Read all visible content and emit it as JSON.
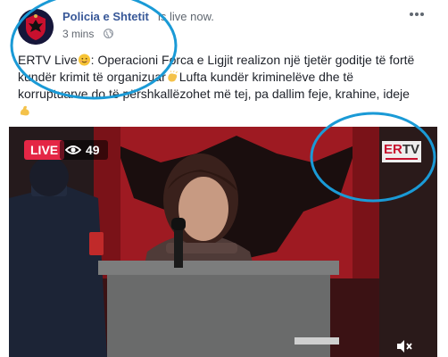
{
  "post": {
    "page_name": "Policia e Shtetit",
    "status_text": "is live now.",
    "timestamp": "3 mins",
    "privacy_icon": "globe-icon",
    "more_icon": "more-options-icon",
    "text_line1_a": "ERTV Live",
    "text_line1_b": ": Operacioni Forca e Ligjit realizon një tjetër goditje të fortë",
    "text_line2_a": "kundër krimit të organizuar",
    "text_line2_b": "Lufta kundër kriminelëve dhe të",
    "text_line3": "korruptuarve do të përshkallëzohet më tej, pa dallim feje, krahine, ideje"
  },
  "video": {
    "live_label": "LIVE",
    "viewer_count": "49",
    "logo_red": "ER",
    "logo_dark": "TV",
    "mute_icon": "speaker-muted-icon"
  },
  "colors": {
    "link": "#385898",
    "live_red": "#e42645",
    "annotation_blue": "#1a9ad6"
  }
}
